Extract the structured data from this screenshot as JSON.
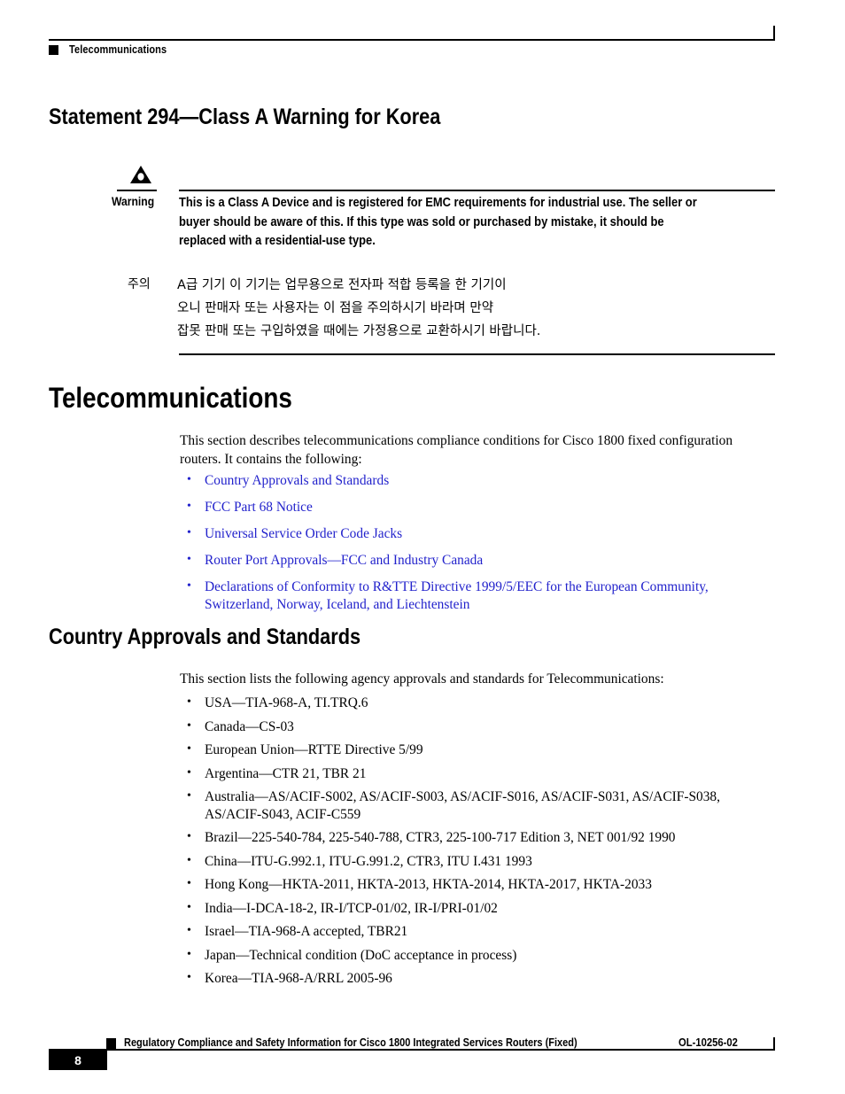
{
  "header": {
    "running_title": "Telecommunications"
  },
  "statement_section": {
    "heading": "Statement 294—Class A Warning for Korea",
    "warning_label": "Warning",
    "warning_icon": "warning-triangle-icon",
    "warning_text": "This is a Class A Device and is registered for EMC requirements for industrial use. The seller or buyer should be aware of this. If this type was sold or purchased by mistake, it should be replaced with a residential-use type.",
    "korean_label": "주의",
    "korean_text": "A급 기기 이 기기는 업무용으로 전자파 적합 등록을 한 기기이\n오니 판매자 또는 사용자는 이 점을 주의하시기 바라며 만약\n잡못 판매 또는 구입하였을 때에는 가정용으로 교환하시기 바랍니다."
  },
  "telecom_section": {
    "heading": "Telecommunications",
    "intro": "This section describes telecommunications compliance conditions for Cisco 1800 fixed configuration routers. It contains the following:",
    "links": [
      "Country Approvals and Standards",
      "FCC Part 68 Notice",
      "Universal Service Order Code Jacks",
      "Router Port Approvals—FCC and Industry Canada",
      "Declarations of Conformity to R&TTE Directive 1999/5/EEC for the European Community, Switzerland, Norway, Iceland, and Liechtenstein"
    ],
    "link_color": "#2222cc"
  },
  "country_section": {
    "heading": "Country Approvals and Standards",
    "intro": "This section lists the following agency approvals and standards for Telecommunications:",
    "items": [
      "USA—TIA-968-A, TI.TRQ.6",
      "Canada—CS-03",
      "European Union—RTTE Directive 5/99",
      "Argentina—CTR 21, TBR 21",
      "Australia—AS/ACIF-S002, AS/ACIF-S003, AS/ACIF-S016, AS/ACIF-S031, AS/ACIF-S038, AS/ACIF-S043, ACIF-C559",
      "Brazil—225-540-784, 225-540-788, CTR3, 225-100-717 Edition 3, NET 001/92 1990",
      "China—ITU-G.992.1, ITU-G.991.2, CTR3, ITU I.431 1993",
      "Hong Kong—HKTA-2011, HKTA-2013, HKTA-2014, HKTA-2017, HKTA-2033",
      "India—I-DCA-18-2, IR-I/TCP-01/02, IR-I/PRI-01/02",
      "Israel—TIA-968-A accepted, TBR21",
      "Japan—Technical condition (DoC acceptance in process)",
      "Korea—TIA-968-A/RRL 2005-96"
    ]
  },
  "footer": {
    "doc_title": "Regulatory Compliance and Safety Information for Cisco 1800 Integrated Services Routers (Fixed)",
    "page_number": "8",
    "doc_id": "OL-10256-02"
  }
}
